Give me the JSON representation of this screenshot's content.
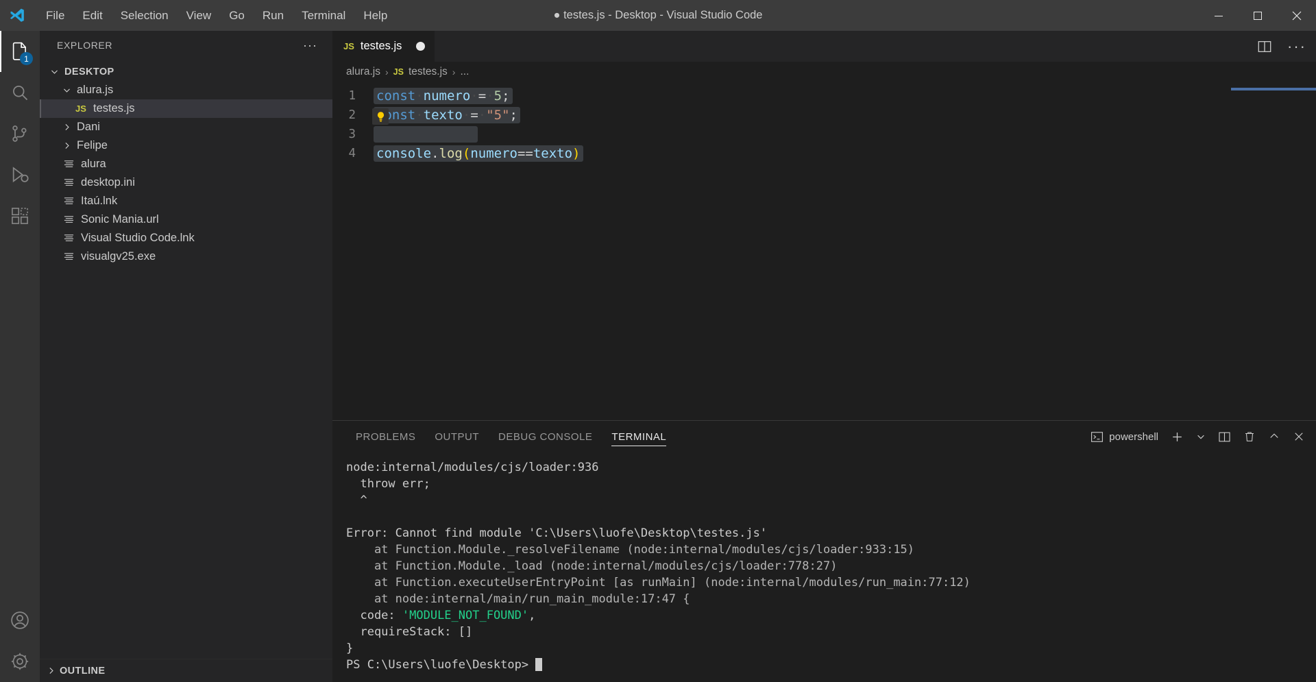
{
  "window": {
    "title": "● testes.js - Desktop - Visual Studio Code",
    "minimize_label": "Minimize",
    "maximize_label": "Restore",
    "close_label": "Close"
  },
  "menu": {
    "items": [
      {
        "label": "File"
      },
      {
        "label": "Edit"
      },
      {
        "label": "Selection"
      },
      {
        "label": "View"
      },
      {
        "label": "Go"
      },
      {
        "label": "Run"
      },
      {
        "label": "Terminal"
      },
      {
        "label": "Help"
      }
    ]
  },
  "activity_bar": {
    "items": [
      {
        "name": "explorer",
        "icon": "files-icon",
        "badge": "1",
        "active": true
      },
      {
        "name": "search",
        "icon": "search-icon",
        "badge": "",
        "active": false
      },
      {
        "name": "source-control",
        "icon": "source-control-icon",
        "badge": "",
        "active": false
      },
      {
        "name": "run-and-debug",
        "icon": "run-debug-icon",
        "badge": "",
        "active": false
      },
      {
        "name": "extensions",
        "icon": "extensions-icon",
        "badge": "",
        "active": false
      },
      {
        "name": "accounts",
        "icon": "account-icon",
        "badge": "",
        "active": false
      },
      {
        "name": "settings",
        "icon": "gear-icon",
        "badge": "",
        "active": false
      }
    ]
  },
  "sidebar": {
    "title": "EXPLORER",
    "more_label": "···",
    "outline_label": "OUTLINE",
    "tree": [
      {
        "label": "DESKTOP",
        "kind": "root",
        "expanded": true,
        "indent": 0,
        "selected": false
      },
      {
        "label": "alura.js",
        "kind": "folder",
        "expanded": true,
        "indent": 1,
        "selected": false
      },
      {
        "label": "testes.js",
        "kind": "js",
        "expanded": null,
        "indent": 2,
        "selected": true
      },
      {
        "label": "Dani",
        "kind": "folder",
        "expanded": false,
        "indent": 1,
        "selected": false
      },
      {
        "label": "Felipe",
        "kind": "folder",
        "expanded": false,
        "indent": 1,
        "selected": false
      },
      {
        "label": "alura",
        "kind": "file",
        "expanded": null,
        "indent": 1,
        "selected": false
      },
      {
        "label": "desktop.ini",
        "kind": "file",
        "expanded": null,
        "indent": 1,
        "selected": false
      },
      {
        "label": "Itaú.lnk",
        "kind": "file",
        "expanded": null,
        "indent": 1,
        "selected": false
      },
      {
        "label": "Sonic Mania.url",
        "kind": "file",
        "expanded": null,
        "indent": 1,
        "selected": false
      },
      {
        "label": "Visual Studio Code.lnk",
        "kind": "file",
        "expanded": null,
        "indent": 1,
        "selected": false
      },
      {
        "label": "visualgv25.exe",
        "kind": "file",
        "expanded": null,
        "indent": 1,
        "selected": false
      }
    ]
  },
  "editor": {
    "tab": {
      "label": "testes.js",
      "icon": "js-icon",
      "dirty": true
    },
    "actions": {
      "split_label": "Split Editor",
      "more_label": "More Actions"
    },
    "breadcrumb": [
      {
        "label": "alura.js",
        "icon": ""
      },
      {
        "label": "testes.js",
        "icon": "js-icon"
      },
      {
        "label": "...",
        "icon": ""
      }
    ],
    "breadcrumb_separator": "›",
    "lines": [
      {
        "number": "1",
        "text": "const numero = 5;"
      },
      {
        "number": "2",
        "text": "const texto = \"5\";"
      },
      {
        "number": "3",
        "text": ""
      },
      {
        "number": "4",
        "text": "console.log(numero==texto)"
      }
    ],
    "lightbulb_icon": "lightbulb-icon"
  },
  "panel": {
    "tabs": [
      {
        "label": "PROBLEMS",
        "active": false
      },
      {
        "label": "OUTPUT",
        "active": false
      },
      {
        "label": "DEBUG CONSOLE",
        "active": false
      },
      {
        "label": "TERMINAL",
        "active": true
      }
    ],
    "shell_label": "powershell",
    "actions": {
      "new_terminal_label": "+",
      "dropdown_label": "⌄",
      "split_label": "Split Terminal",
      "kill_label": "Kill Terminal",
      "maximize_label": "Maximize Panel",
      "close_label": "Close Panel"
    },
    "terminal_lines": [
      "node:internal/modules/cjs/loader:936",
      "  throw err;",
      "  ^",
      "",
      "Error: Cannot find module 'C:\\Users\\luofe\\Desktop\\testes.js'",
      "    at Function.Module._resolveFilename (node:internal/modules/cjs/loader:933:15)",
      "    at Function.Module._load (node:internal/modules/cjs/loader:778:27)",
      "    at Function.executeUserEntryPoint [as runMain] (node:internal/modules/run_main:77:12)",
      "    at node:internal/main/run_main_module:17:47 {",
      "  code: 'MODULE_NOT_FOUND',",
      "  requireStack: []",
      "}"
    ],
    "prompt": "PS C:\\Users\\luofe\\Desktop> ",
    "error_code_value": "'MODULE_NOT_FOUND'"
  },
  "colors": {
    "accent": "#0e639c",
    "titlebar_bg": "#3c3c3c",
    "sidebar_bg": "#252526",
    "editor_bg": "#1e1e1e",
    "activity_bg": "#333333",
    "selection_bg": "#37373d"
  }
}
